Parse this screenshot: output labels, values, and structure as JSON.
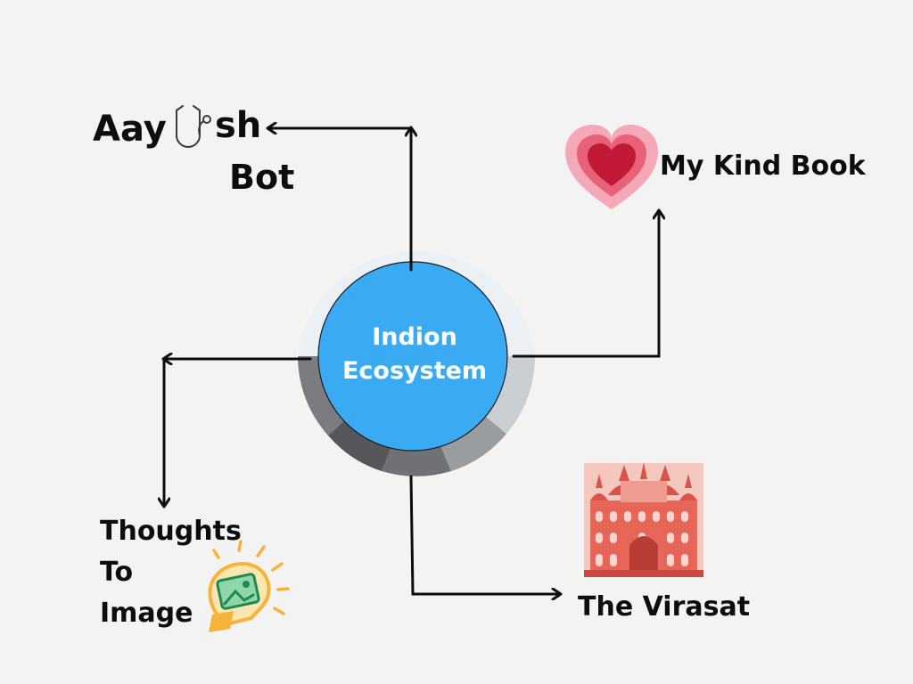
{
  "center": {
    "line1": "Indion",
    "line2": "Ecosystem"
  },
  "nodes": {
    "aayush_bot": {
      "part1": "Aay",
      "part2": "sh",
      "part3": "Bot",
      "icon": "stethoscope-icon"
    },
    "my_kind_book": {
      "label": "My Kind Book",
      "icon": "heart-icon"
    },
    "thoughts_to_image": {
      "line1": "Thoughts",
      "line2": "To",
      "line3": "Image",
      "icon": "lightbulb-image-icon"
    },
    "the_virasat": {
      "label": "The Virasat",
      "icon": "palace-icon"
    }
  },
  "colors": {
    "background": "#f3f3f3",
    "center_fill": "#3aaaf2",
    "arrow": "#0d0d0d",
    "heart_outer": "#f2a7b6",
    "heart_inner": "#c41f3a",
    "bulb": "#f6b23a",
    "palace": "#e6675a"
  }
}
